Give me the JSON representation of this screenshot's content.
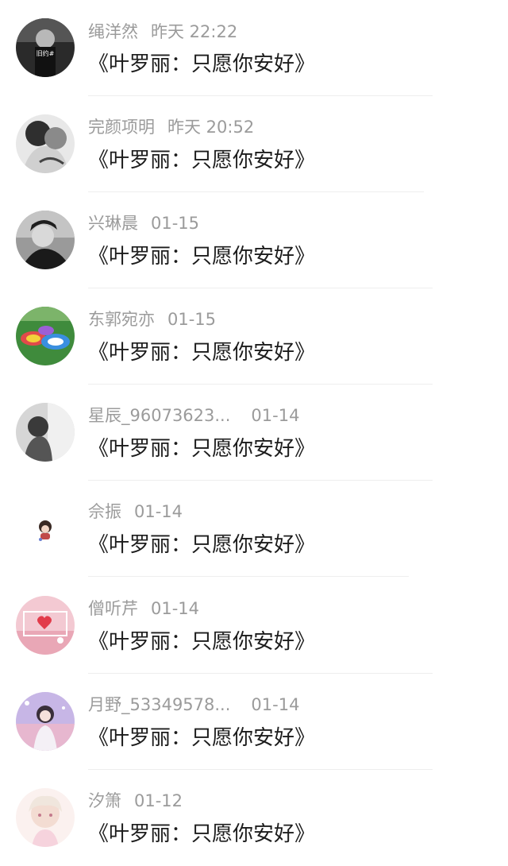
{
  "comments": [
    {
      "name": "绳洋然",
      "time": "昨天 22:22",
      "text": "《叶罗丽：只愿你安好》",
      "avatar_text": "旧约#"
    },
    {
      "name": "完颜项明",
      "time": "昨天 20:52",
      "text": "《叶罗丽：只愿你安好》"
    },
    {
      "name": "兴琳晨",
      "time": "01-15",
      "text": "《叶罗丽：只愿你安好》"
    },
    {
      "name": "东郭宛亦",
      "time": "01-15",
      "text": "《叶罗丽：只愿你安好》"
    },
    {
      "name": "星辰_96073623...",
      "time": "01-14",
      "text": "《叶罗丽：只愿你安好》"
    },
    {
      "name": "佘振",
      "time": "01-14",
      "text": "《叶罗丽：只愿你安好》"
    },
    {
      "name": "僧听芹",
      "time": "01-14",
      "text": "《叶罗丽：只愿你安好》"
    },
    {
      "name": "月野_53349578...",
      "time": "01-14",
      "text": "《叶罗丽：只愿你安好》"
    },
    {
      "name": "汐箫",
      "time": "01-12",
      "text": "《叶罗丽：只愿你安好》"
    }
  ]
}
